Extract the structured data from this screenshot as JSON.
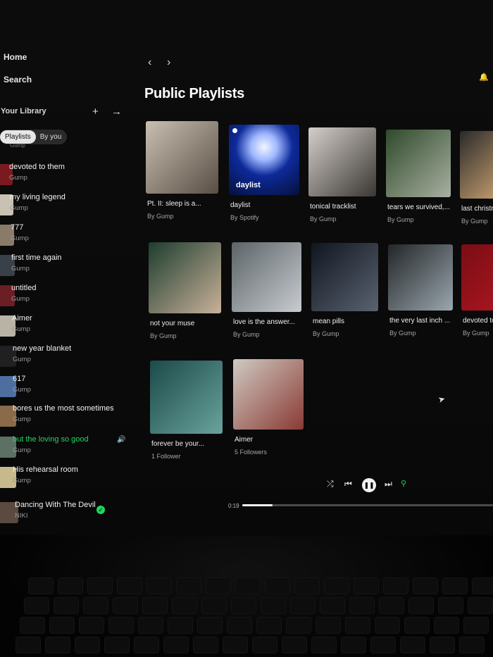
{
  "nav": {
    "home": "Home",
    "search": "Search"
  },
  "library": {
    "title": "Your Library",
    "filters": [
      "Playlists",
      "By you"
    ],
    "partial_top": "Gump",
    "items": [
      {
        "name": "devoted to them",
        "sub": "Gump",
        "color": "#7a1a20"
      },
      {
        "name": "my living legend",
        "sub": "Gump",
        "color": "#c9c1b3"
      },
      {
        "name": "777",
        "sub": "Gump",
        "color": "#8a7a6a"
      },
      {
        "name": "first time again",
        "sub": "Gump",
        "color": "#3a4048"
      },
      {
        "name": "untitled",
        "sub": "Gump",
        "color": "#6b1e24"
      },
      {
        "name": "Aimer",
        "sub": "Gump",
        "color": "#b9b3a6"
      },
      {
        "name": "new year blanket",
        "sub": "Gump",
        "color": "#202020"
      },
      {
        "name": "617",
        "sub": "Gump",
        "color": "#4c6fa0"
      },
      {
        "name": "bores us the most sometimes",
        "sub": "Gump",
        "color": "#8a6a48"
      },
      {
        "name": "but the loving so good",
        "sub": "Gump",
        "color": "#5c7064",
        "playing": true
      },
      {
        "name": "His rehearsal room",
        "sub": "Gump",
        "color": "#c8b98c"
      },
      {
        "name": "Dancing With The Devil",
        "sub": "NIKI",
        "color": "#5a4a40",
        "verified": true
      }
    ]
  },
  "main": {
    "title": "Public Playlists",
    "cards": [
      {
        "title": "Pt. II: sleep is a...",
        "sub": "By Gump",
        "colors": [
          "#c8c0b2",
          "#5a4e44"
        ]
      },
      {
        "title": "daylist",
        "sub": "By Spotify",
        "colors": [
          "#0d2a9a",
          "#f2f6ff"
        ],
        "cover_label": "daylist"
      },
      {
        "title": "tonical tracklist",
        "sub": "By Gump",
        "colors": [
          "#d4cfca",
          "#3a3632"
        ]
      },
      {
        "title": "tears we survived,...",
        "sub": "By Gump",
        "colors": [
          "#2f4a2a",
          "#a8b0a2"
        ]
      },
      {
        "title": "last christm",
        "sub": "By Gump",
        "colors": [
          "#2a2a2a",
          "#c8a070"
        ]
      },
      {
        "title": "not your muse",
        "sub": "By Gump",
        "colors": [
          "#1d3d2f",
          "#c9b199"
        ]
      },
      {
        "title": "love is the answer...",
        "sub": "By Gump",
        "colors": [
          "#5c6468",
          "#c8ccd0"
        ]
      },
      {
        "title": "mean pills",
        "sub": "By Gump",
        "colors": [
          "#101620",
          "#5a6270"
        ]
      },
      {
        "title": "the very last inch ...",
        "sub": "By Gump",
        "colors": [
          "#222628",
          "#9aa6ae"
        ]
      },
      {
        "title": "devoted to",
        "sub": "By Gump",
        "colors": [
          "#7a0d14",
          "#a8161f"
        ]
      },
      {
        "title": "forever be your...",
        "sub": "1 Follower",
        "colors": [
          "#1b4a4a",
          "#6aa39c"
        ]
      },
      {
        "title": "Aimer",
        "sub": "5 Followers",
        "colors": [
          "#cfcac2",
          "#8a3a34"
        ]
      }
    ]
  },
  "player": {
    "elapsed": "0:19",
    "progress": 0.12,
    "icons": [
      "shuffle-icon",
      "previous-icon",
      "pause-icon",
      "next-icon",
      "lyrics-icon"
    ]
  }
}
